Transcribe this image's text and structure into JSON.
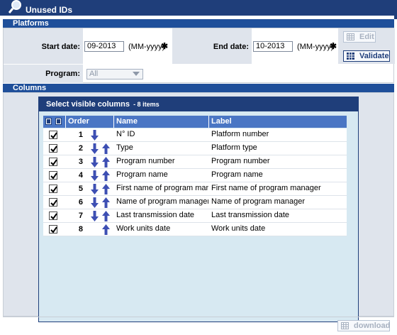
{
  "window": {
    "title": "Unused IDs",
    "icon": "magnifier-icon"
  },
  "platforms": {
    "section_title": "Platforms",
    "start_label": "Start date:",
    "start_value": "09-2013",
    "start_hint": "(MM-yyyy)",
    "end_label": "End date:",
    "end_value": "10-2013",
    "end_hint": "(MM-yyyy)",
    "required_marker": "✱",
    "program_label": "Program:",
    "program_value": "All",
    "edit_label": "Edit",
    "validate_label": "Validate"
  },
  "columns": {
    "section_title": "Columns",
    "dialog_title": "Select visible columns",
    "dialog_count": "- 8 items",
    "headers": {
      "order": "Order",
      "name": "Name",
      "label": "Label"
    },
    "rows": [
      {
        "checked": true,
        "order": "1",
        "name": "N° ID",
        "label": "Platform number",
        "down": true,
        "up": false
      },
      {
        "checked": true,
        "order": "2",
        "name": "Type",
        "label": "Platform type",
        "down": true,
        "up": true
      },
      {
        "checked": true,
        "order": "3",
        "name": "Program number",
        "label": "Program number",
        "down": true,
        "up": true
      },
      {
        "checked": true,
        "order": "4",
        "name": "Program name",
        "label": "Program name",
        "down": true,
        "up": true
      },
      {
        "checked": true,
        "order": "5",
        "name": "First name of program manag",
        "label": "First name of program manager",
        "down": true,
        "up": true
      },
      {
        "checked": true,
        "order": "6",
        "name": "Name of program manager",
        "label": "Name of program manager",
        "down": true,
        "up": true
      },
      {
        "checked": true,
        "order": "7",
        "name": "Last transmission date",
        "label": "Last transmission date",
        "down": true,
        "up": true
      },
      {
        "checked": true,
        "order": "8",
        "name": "Work units date",
        "label": "Work units date",
        "down": false,
        "up": true
      }
    ]
  },
  "footer": {
    "download_label": "download"
  },
  "colors": {
    "navy": "#1f3e7a",
    "header_blue": "#4a76c4",
    "panel_grey": "#dfe4ec",
    "dialog_bg": "#d7e9f2",
    "arrow": "#3d4fb3"
  }
}
